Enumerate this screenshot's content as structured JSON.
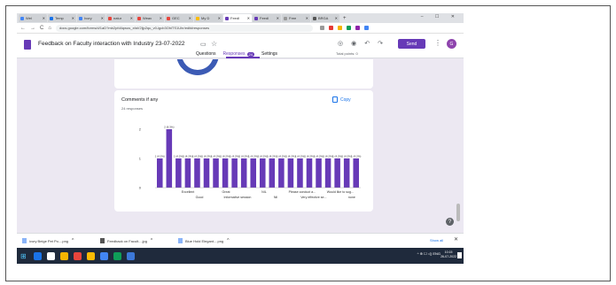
{
  "browser": {
    "tabs": [
      {
        "label": "Wel",
        "color": "#4285f4"
      },
      {
        "label": "Temp",
        "color": "#1a73e8"
      },
      {
        "label": "Ivory",
        "color": "#4285f4"
      },
      {
        "label": "natur",
        "color": "#e8453c"
      },
      {
        "label": "Weav",
        "color": "#e8453c"
      },
      {
        "label": "GEC",
        "color": "#e8453c"
      },
      {
        "label": "My D",
        "color": "#fbbc04"
      },
      {
        "label": "Feedl",
        "color": "#673ab7",
        "active": true
      },
      {
        "label": "Feedl",
        "color": "#673ab7"
      },
      {
        "label": "Free",
        "color": "#999999"
      },
      {
        "label": "BRGA",
        "color": "#555555"
      }
    ],
    "new_tab": "+",
    "window_controls": "– ☐ ✕",
    "back": "←",
    "forward": "→",
    "reload": "C",
    "home": "⌂",
    "url": "docs.google.com/forms/d/1aD?mb2pfd4qwos_xfaV2ljp2qu_v0-igcb3OhiTS1Uhr/edit#responses",
    "extension_colors": [
      "#999999",
      "#e53935",
      "#f4b400",
      "#0f9d58",
      "#8e24aa",
      "#4285f4"
    ]
  },
  "forms_header": {
    "title": "Feedback on Faculty interaction with Industry 23-07-2022",
    "send_label": "Send",
    "avatar_letter": "G",
    "tabs": [
      {
        "label": "Questions"
      },
      {
        "label": "Responses",
        "badge": "24",
        "active": true
      },
      {
        "label": "Settings"
      }
    ],
    "total_points": "Total points: 0"
  },
  "card": {
    "title": "Comments if any",
    "subtitle": "24 responses",
    "copy_label": "Copy"
  },
  "chart_data": {
    "type": "bar",
    "y_ticks": [
      "0",
      "1",
      "2"
    ],
    "ylim": [
      0,
      2
    ],
    "color": "#673ab7",
    "values": [
      1,
      2,
      1,
      1,
      1,
      1,
      1,
      1,
      1,
      1,
      1,
      1,
      1,
      1,
      1,
      1,
      1,
      1,
      1,
      1,
      1,
      1
    ],
    "data_labels": [
      "1 (4.2%)",
      "2 (8.3%)",
      "1 (4.2%)",
      "1 (4.2%)",
      "1 (4.2%)",
      "1 (4.2%)",
      "1 (4.2%)",
      "1 (4.2%)",
      "1 (4.2%)",
      "1 (4.2%)",
      "1 (4.2%)",
      "1 (4.2%)",
      "1 (4.2%)",
      "1 (4.2%)",
      "1 (4.2%)",
      "1 (4.2%)",
      "1 (4.2%)",
      "1 (4.2%)",
      "1 (4.2%)",
      "1 (4.2%)",
      "1 (4.2%)",
      "1 (4.2%)"
    ],
    "x_labels_row1": [
      "Excellent",
      "Great",
      "NIL",
      "Please conduct a...",
      "Would like to sug..."
    ],
    "x_labels_row2": [
      "Good",
      "Informative session",
      "Nil",
      "Very effective se...",
      "none"
    ]
  },
  "downloads": [
    {
      "label": "ivory Beige Pet Po....png",
      "icon": "image"
    },
    {
      "label": "Feedback on Facult....jpg",
      "icon": "image-dark"
    },
    {
      "label": "Blue Hold Elegant....png",
      "icon": "image"
    }
  ],
  "downloads_show_all": "Show all",
  "downloads_close": "✕",
  "taskbar": {
    "app_colors": [
      "#1a73e8",
      "#ffffff",
      "#f4b400",
      "#e8453c",
      "#fbbc04",
      "#4285f4",
      "#0f9d58",
      "#3c78d8"
    ],
    "tray": "^ ⊕ ☐ ◁) ENG",
    "time": "10:15",
    "date": "26-07-2022"
  }
}
